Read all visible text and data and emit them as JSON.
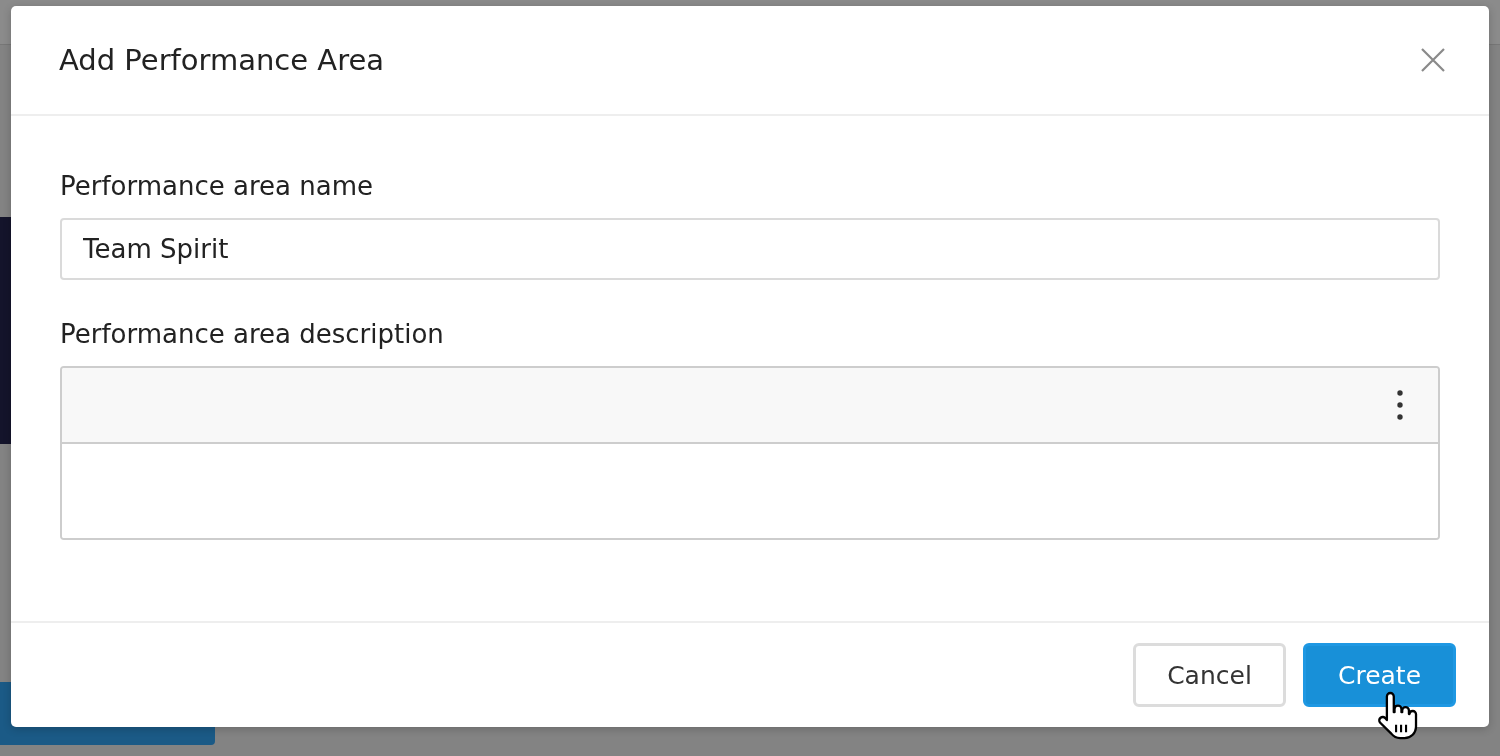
{
  "dialog": {
    "title": "Add Performance Area"
  },
  "fields": [
    {
      "kind": "text",
      "label": "Performance area name",
      "value": "Team Spirit"
    },
    {
      "kind": "editor",
      "label": "Performance area description"
    }
  ],
  "buttons": [
    {
      "kind": "secondary",
      "label": "Cancel",
      "hovered": false
    },
    {
      "kind": "primary",
      "label": "Create",
      "hovered": true
    }
  ]
}
